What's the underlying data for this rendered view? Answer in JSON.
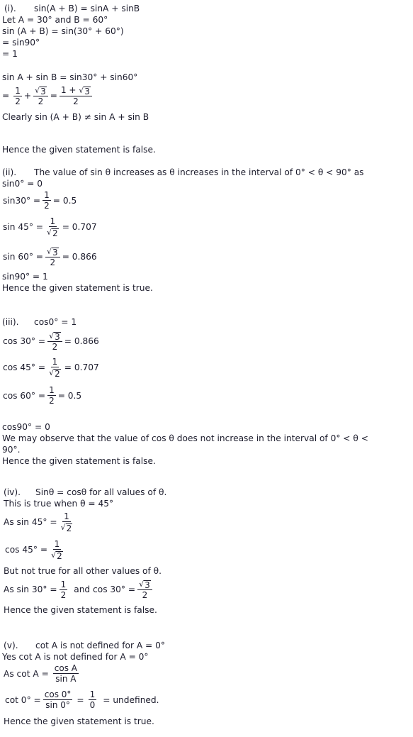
{
  "parts": {
    "i": {
      "label": "(i).",
      "statement": "sin(A + B) = sinA  + sinB",
      "lines": [
        "Let A = 30° and B = 60°",
        "sin (A + B) = sin(30°  + 60°)",
        "= sin90°",
        "= 1",
        "sin A + sin B = sin30°  + sin60°"
      ],
      "frac1": {
        "num": "1",
        "den": "2"
      },
      "frac2": {
        "num": "3",
        "den": "2"
      },
      "frac3": {
        "num_prefix": "1 + ",
        "num": "3",
        "den": "2"
      },
      "eq": "=",
      "plus": "+",
      "clearly": "Clearly sin (A + B) ≠ sin A + sin B",
      "conclusion": "Hence the given statement is false."
    },
    "ii": {
      "label": "(ii).",
      "statement": "The value of sin θ increases as θ increases in the interval of 0°  < θ < 90° as",
      "sin0": "sin0° = 0",
      "sin30": {
        "lhs": "sin30° =",
        "num": "1",
        "den": "2",
        "rhs": "= 0.5"
      },
      "sin45": {
        "lhs": "sin 45° =",
        "num": "1",
        "den": "2",
        "rhs": "= 0.707"
      },
      "sin60": {
        "lhs": "sin 60° =",
        "num": "3",
        "den": "2",
        "rhs": "= 0.866"
      },
      "sin90": "sin90° = 1",
      "conclusion": "Hence the given statement is true."
    },
    "iii": {
      "label": "(iii).",
      "statement": "cos0° = 1",
      "cos30": {
        "lhs": "cos 30° =",
        "num": "3",
        "den": "2",
        "rhs": "= 0.866"
      },
      "cos45": {
        "lhs": "cos 45° =",
        "num": "1",
        "den": "2",
        "rhs": "= 0.707"
      },
      "cos60": {
        "lhs": "cos 60° =",
        "num": "1",
        "den": "2",
        "rhs": "= 0.5"
      },
      "cos90": "cos90° = 0",
      "observe": "We may observe that the value of cos θ does not increase in the interval of 0°  < θ <",
      "observe2": "90°.",
      "conclusion": "Hence the given statement is false."
    },
    "iv": {
      "label": "(iv).",
      "statement": "Sinθ = cosθ for all values of θ.",
      "true_when": "This is true when θ = 45°",
      "sin45": {
        "lhs": "As  sin 45° =",
        "num": "1",
        "den": "2"
      },
      "cos45": {
        "lhs": "cos 45° =",
        "num": "1",
        "den": "2"
      },
      "not_true": "But not true for all other values of θ.",
      "sin30": {
        "lhs": "As  sin 30° =",
        "num": "1",
        "den": "2"
      },
      "and": "and  cos 30° =",
      "cos30": {
        "num": "3",
        "den": "2"
      },
      "conclusion": "Hence the given statement is false."
    },
    "v": {
      "label": "(v).",
      "statement": "cot A is not defined for A = 0°",
      "yes": "Yes cot A is not defined for A = 0°",
      "cotA": {
        "lhs": "As  cot A =",
        "num": "cos A",
        "den": "sin A"
      },
      "cot0": {
        "lhs": "cot 0° =",
        "num": "cos 0°",
        "den": "sin 0°",
        "eq": "=",
        "num2": "1",
        "den2": "0",
        "rhs": "= undefined."
      },
      "conclusion": "Hence the given statement is true."
    }
  }
}
